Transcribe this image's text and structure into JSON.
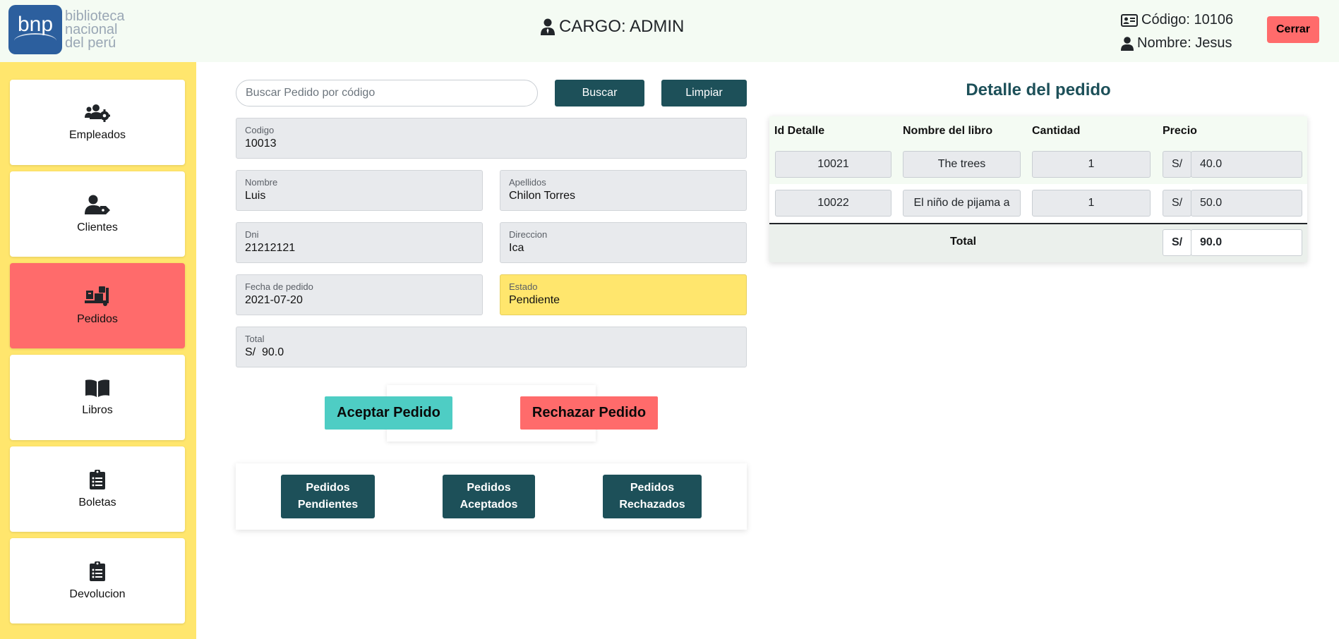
{
  "header": {
    "logo": {
      "mark": "bnp",
      "line1": "biblioteca",
      "line2": "nacional",
      "line3": "del perú"
    },
    "cargo": "CARGO: ADMIN",
    "codigo": "Código: 10106",
    "nombre": "Nombre: Jesus",
    "cerrar": "Cerrar"
  },
  "sidebar": {
    "items": [
      {
        "label": "Empleados",
        "icon": "users-gear-icon"
      },
      {
        "label": "Clientes",
        "icon": "user-tag-icon"
      },
      {
        "label": "Pedidos",
        "icon": "dolly-icon",
        "active": true
      },
      {
        "label": "Libros",
        "icon": "book-open-icon"
      },
      {
        "label": "Boletas",
        "icon": "clipboard-list-icon"
      },
      {
        "label": "Devolucion",
        "icon": "clipboard-list-icon"
      }
    ]
  },
  "search": {
    "placeholder": "Buscar Pedido por código",
    "buscar": "Buscar",
    "limpiar": "Limpiar"
  },
  "form": {
    "codigo": {
      "label": "Codigo",
      "value": "10013"
    },
    "nombre": {
      "label": "Nombre",
      "value": "Luis"
    },
    "apellidos": {
      "label": "Apellidos",
      "value": "Chilon Torres"
    },
    "dni": {
      "label": "Dni",
      "value": "21212121"
    },
    "direccion": {
      "label": "Direccion",
      "value": "Ica"
    },
    "fecha": {
      "label": "Fecha de pedido",
      "value": "2021-07-20"
    },
    "estado": {
      "label": "Estado",
      "value": "Pendiente"
    },
    "total": {
      "label": "Total",
      "value": "S/  90.0"
    }
  },
  "actions": {
    "aceptar": "Aceptar Pedido",
    "rechazar": "Rechazar Pedido"
  },
  "filters": {
    "pendientes": [
      "Pedidos",
      "Pendientes"
    ],
    "aceptados": [
      "Pedidos",
      "Aceptados"
    ],
    "rechazados": [
      "Pedidos",
      "Rechazados"
    ]
  },
  "detail": {
    "title": "Detalle del pedido",
    "columns": [
      "Id Detalle",
      "Nombre del libro",
      "Cantidad",
      "Precio"
    ],
    "rows": [
      {
        "id": "10021",
        "libro": "The trees",
        "cantidad": "1",
        "moneda": "S/",
        "precio": "40.0"
      },
      {
        "id": "10022",
        "libro": "El niño de pijama a",
        "cantidad": "1",
        "moneda": "S/",
        "precio": "50.0"
      }
    ],
    "total_label": "Total",
    "total_moneda": "S/",
    "total_value": "90.0"
  },
  "colors": {
    "teal": "#1d5059",
    "yellow": "#ffe66d",
    "red": "#ff6b6b",
    "aqua": "#4ecdc4"
  }
}
